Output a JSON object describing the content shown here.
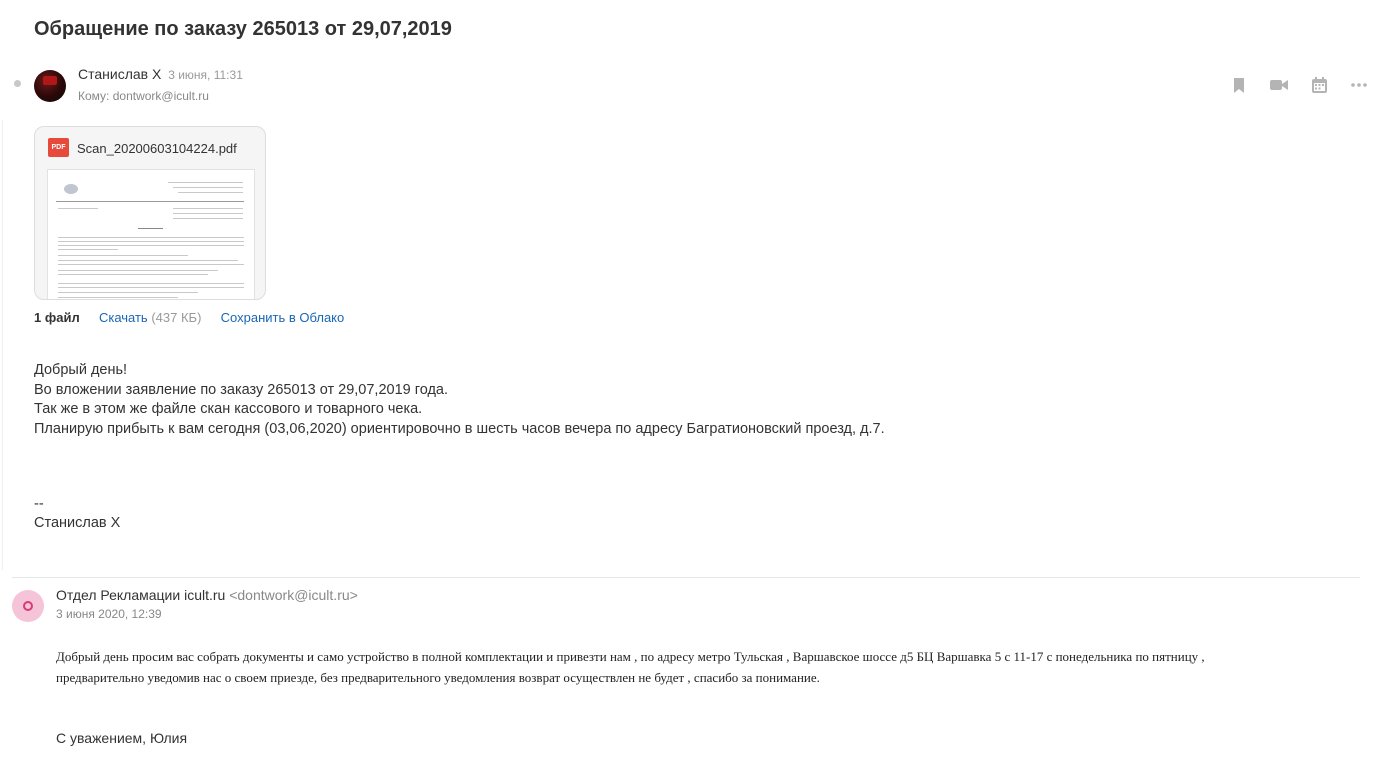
{
  "subject": "Обращение по заказу 265013 от 29,07,2019",
  "message1": {
    "sender_name": "Станислав Х",
    "date": "3 июня, 11:31",
    "to": "Кому: dontwork@icult.ru",
    "attachment": {
      "badge": "PDF",
      "filename": "Scan_20200603104224.pdf"
    },
    "files": {
      "count": "1 файл",
      "download": "Скачать",
      "size": "(437 КБ)",
      "save_cloud": "Сохранить в Облако"
    },
    "body_lines": [
      "Добрый день!",
      "Во вложении заявление по заказу 265013 от 29,07,2019 года.",
      "Так же в этом же файле скан кассового и товарного чека.",
      "Планирую прибыть к вам сегодня (03,06,2020) ориентировочно в шесть часов вечера по адресу Багратионовский проезд, д.7."
    ],
    "signature_dash": "--",
    "signature_name": "Станислав Х"
  },
  "actions": {
    "icons": [
      "bookmark-icon",
      "video-icon",
      "calendar-icon",
      "more-icon"
    ]
  },
  "message2": {
    "sender_name": "Отдел Рекламации icult.ru",
    "sender_email": "<dontwork@icult.ru>",
    "date": "3 июня 2020, 12:39",
    "body_lines": [
      "Добрый день просим вас собрать документы и само устройство в полной комплектации и привезти нам  , по адресу метро Тульская , Варшавское шоссе д5 БЦ Варшавка 5 с 11-17 с понедельника по пятницу ,",
      "предварительно уведомив нас о своем приезде, без предварительного уведомления возврат осуществлен не будет , спасибо за понимание."
    ],
    "signature": "С уважением, Юлия"
  },
  "colors": {
    "link": "#1a66b5",
    "pdf_badge": "#e64a3b",
    "avatar2_bg": "#f6c4d8",
    "avatar2_ring": "#d83c74",
    "icon_gray": "#b4b4b4"
  }
}
